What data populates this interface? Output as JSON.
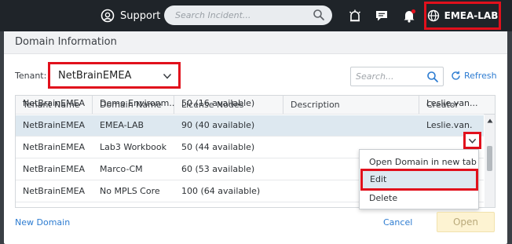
{
  "topbar": {
    "support_label": "Support",
    "search_placeholder": "Search Incident...",
    "domain_button_label": "EMEA-LAB"
  },
  "dialog": {
    "title": "Domain Information",
    "tenant_label": "Tenant:",
    "tenant_value": "NetBrainEMEA",
    "search_placeholder": "Search...",
    "refresh_label": "Refresh",
    "columns": [
      "Tenant Name",
      "Domain Name",
      "License Nodes",
      "Description",
      "Creator"
    ],
    "rows": [
      {
        "tenant": "NetBrainEMEA",
        "domain": "Demo Environm...",
        "nodes": "50 (16 available)",
        "description": "",
        "creator": "Leslie.van..."
      },
      {
        "tenant": "NetBrainEMEA",
        "domain": "EMEA-LAB",
        "nodes": "90 (40 available)",
        "description": "",
        "creator": "Leslie.van..."
      },
      {
        "tenant": "NetBrainEMEA",
        "domain": "Lab3 Workbook",
        "nodes": "50 (44 available)",
        "description": "",
        "creator": ""
      },
      {
        "tenant": "NetBrainEMEA",
        "domain": "Marco-CM",
        "nodes": "60 (53 available)",
        "description": "",
        "creator": ""
      },
      {
        "tenant": "NetBrainEMEA",
        "domain": "No MPLS Core",
        "nodes": "100 (64 available)",
        "description": "",
        "creator": ""
      }
    ],
    "context_menu": [
      "Open Domain in new tab",
      "Edit",
      "Delete"
    ],
    "new_domain_label": "New Domain",
    "cancel_label": "Cancel",
    "open_label": "Open"
  },
  "colors": {
    "highlight": "#e1101c",
    "link": "#2d7cd1",
    "topbar": "#1f2429",
    "selected_row": "#dde8f0"
  },
  "icons": [
    "support-icon",
    "search-icon",
    "alarm-icon",
    "chat-icon",
    "bell-icon",
    "globe-icon",
    "chevron-down-icon",
    "refresh-icon",
    "scroll-up-icon"
  ]
}
